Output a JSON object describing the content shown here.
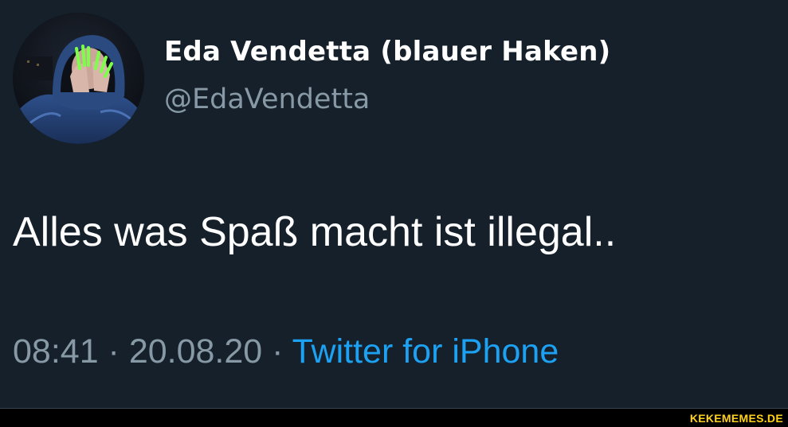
{
  "tweet": {
    "display_name": "Eda Vendetta (blauer Haken)",
    "handle": "@EdaVendetta",
    "text": "Alles was Spaß macht ist illegal..",
    "time": "08:41",
    "separator": " · ",
    "date": "20.08.20",
    "source": "Twitter for iPhone"
  },
  "avatar": {
    "icon": "profile-photo-hooded-person-icon"
  },
  "watermark": {
    "text": "KEKEMEMES.DE"
  },
  "colors": {
    "background": "#15202b",
    "primary_text": "#ffffff",
    "secondary_text": "#8899a6",
    "link": "#1da1f2",
    "divider": "#38444d",
    "watermark": "#ffd21a"
  }
}
